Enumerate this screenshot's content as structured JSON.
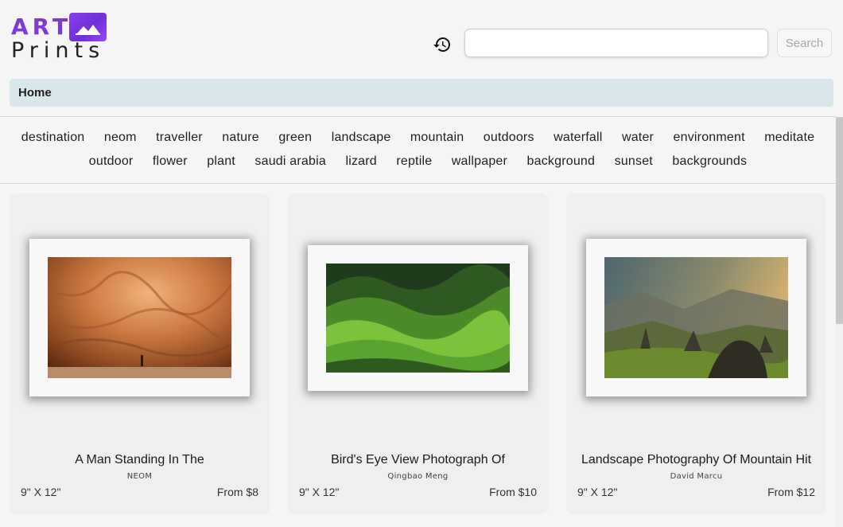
{
  "brand": {
    "line1": "ART",
    "line2": "Prints",
    "accent": "#7e3ad8"
  },
  "search": {
    "placeholder": "",
    "value": "",
    "button_label": "Search"
  },
  "breadcrumb": {
    "home": "Home"
  },
  "tags": {
    "row1": [
      "destination",
      "neom",
      "traveller",
      "nature",
      "green",
      "landscape",
      "mountain",
      "outdoors",
      "waterfall",
      "water",
      "environment",
      "meditate"
    ],
    "row2": [
      "outdoor",
      "flower",
      "plant",
      "saudi arabia",
      "lizard",
      "reptile",
      "wallpaper",
      "background",
      "sunset",
      "backgrounds"
    ]
  },
  "cards": [
    {
      "title": "A Man Standing In The",
      "artist": "NEOM",
      "size": "9\" X 12\"",
      "price": "From $8",
      "image": "canyon-photo"
    },
    {
      "title": "Bird's Eye View Photograph Of",
      "artist": "Qingbao Meng",
      "size": "9\" X 12\"",
      "price": "From $10",
      "image": "green-hills-photo"
    },
    {
      "title": "Landscape Photography Of Mountain Hit",
      "artist": "David Marcu",
      "size": "9\" X 12\"",
      "price": "From $12",
      "image": "mountain-photo"
    }
  ],
  "icons": {
    "history": "history-icon",
    "logo": "image-icon"
  }
}
